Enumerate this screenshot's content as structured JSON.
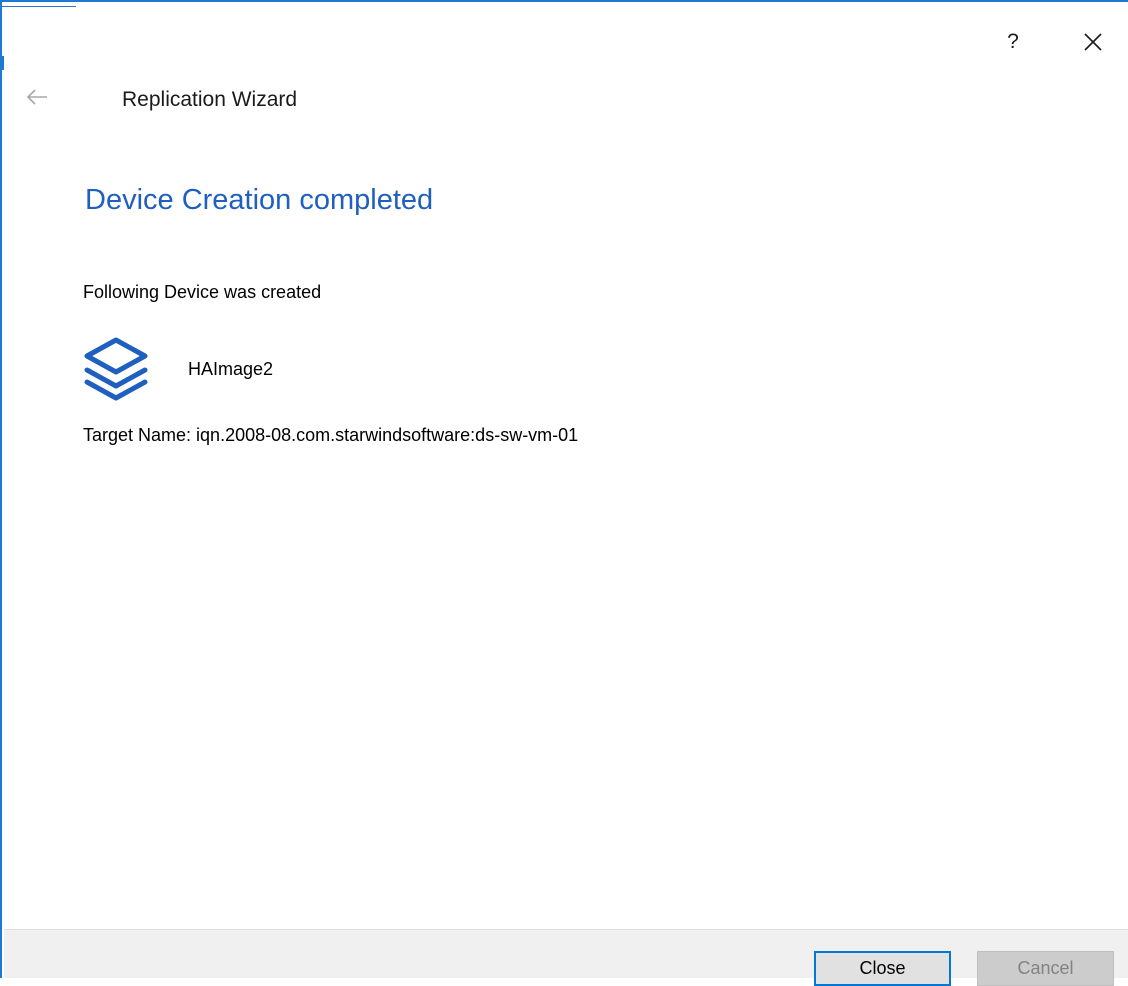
{
  "window": {
    "help_glyph": "?",
    "close_icon": "close-icon",
    "accent_color": "#1e7ad1"
  },
  "header": {
    "back_icon": "arrow-left-icon",
    "wizard_title": "Replication Wizard"
  },
  "page": {
    "heading": "Device Creation completed",
    "heading_color": "#1f5fbf",
    "created_label": "Following Device was created",
    "device": {
      "icon": "layers-stack-icon",
      "name": "HAImage2"
    },
    "target_line": "Target Name: iqn.2008-08.com.starwindsoftware:ds-sw-vm-01"
  },
  "footer": {
    "close_label": "Close",
    "cancel_label": "Cancel"
  }
}
